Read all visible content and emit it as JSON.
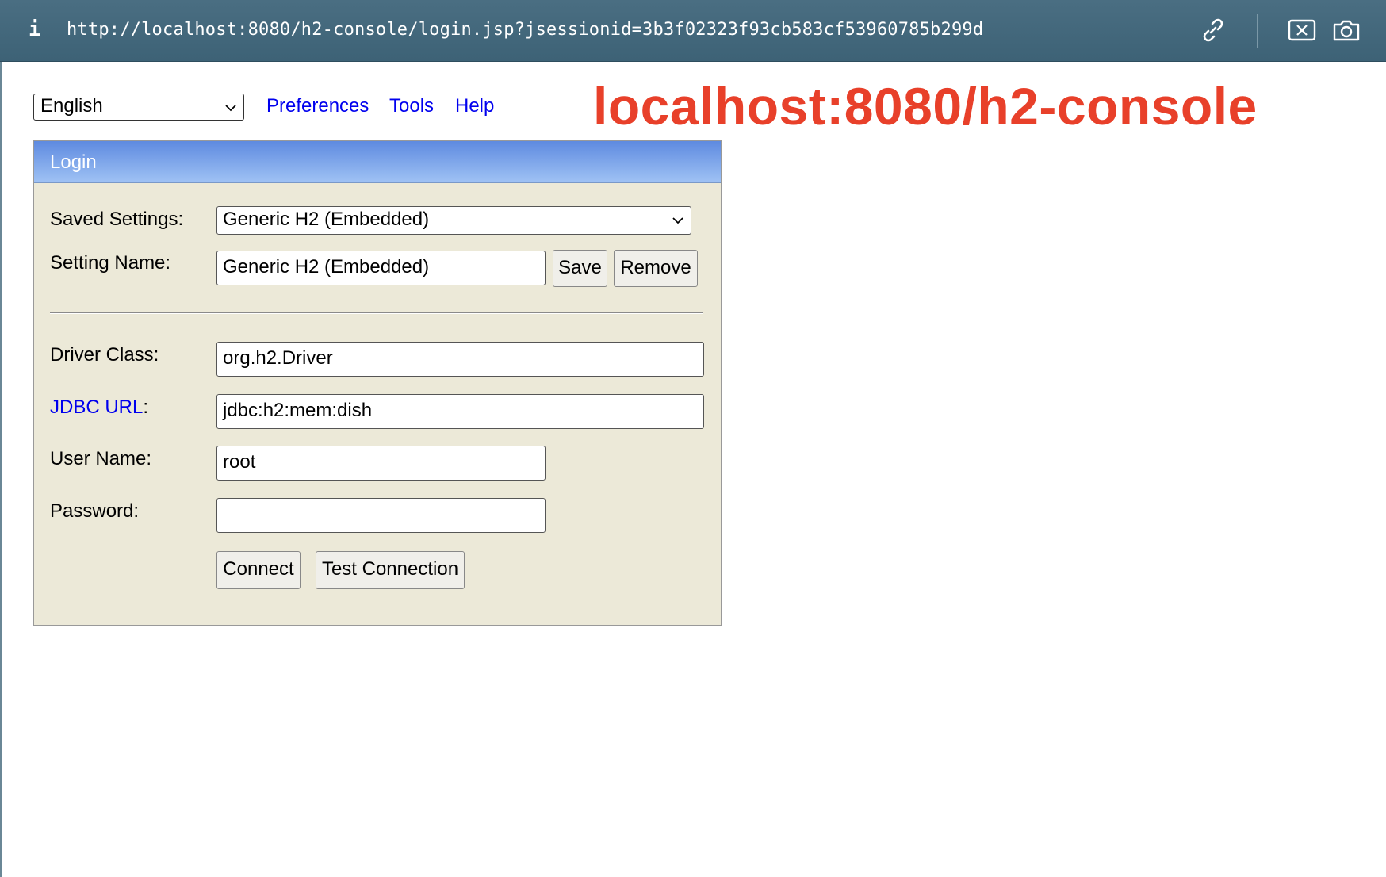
{
  "browser": {
    "info_glyph": "i",
    "url": "http://localhost:8080/h2-console/login.jsp?jsessionid=3b3f02323f93cb583cf53960785b299d",
    "icons": [
      "link-icon",
      "screenshot-area-icon",
      "camera-icon"
    ]
  },
  "toolbar": {
    "language": "English",
    "links": [
      "Preferences",
      "Tools",
      "Help"
    ]
  },
  "annotation": "localhost:8080/h2-console",
  "login": {
    "title": "Login",
    "saved_settings_label": "Saved Settings:",
    "saved_settings_value": "Generic H2 (Embedded)",
    "setting_name_label": "Setting Name:",
    "setting_name_value": "Generic H2 (Embedded)",
    "save_label": "Save",
    "remove_label": "Remove",
    "driver_class_label": "Driver Class:",
    "driver_class_value": "org.h2.Driver",
    "jdbc_url_link": "JDBC URL",
    "jdbc_url_colon": ":",
    "jdbc_url_value": "jdbc:h2:mem:dish",
    "user_name_label": "User Name:",
    "user_name_value": "root",
    "password_label": "Password:",
    "password_value": "",
    "connect_label": "Connect",
    "test_connection_label": "Test Connection"
  },
  "colors": {
    "annotation": "#e8402a",
    "link": "#0000ee",
    "panel_bg": "#ece9d8",
    "header_top": "#5e8ae0",
    "header_bottom": "#9fc2f4",
    "urlbar": "#436878"
  }
}
